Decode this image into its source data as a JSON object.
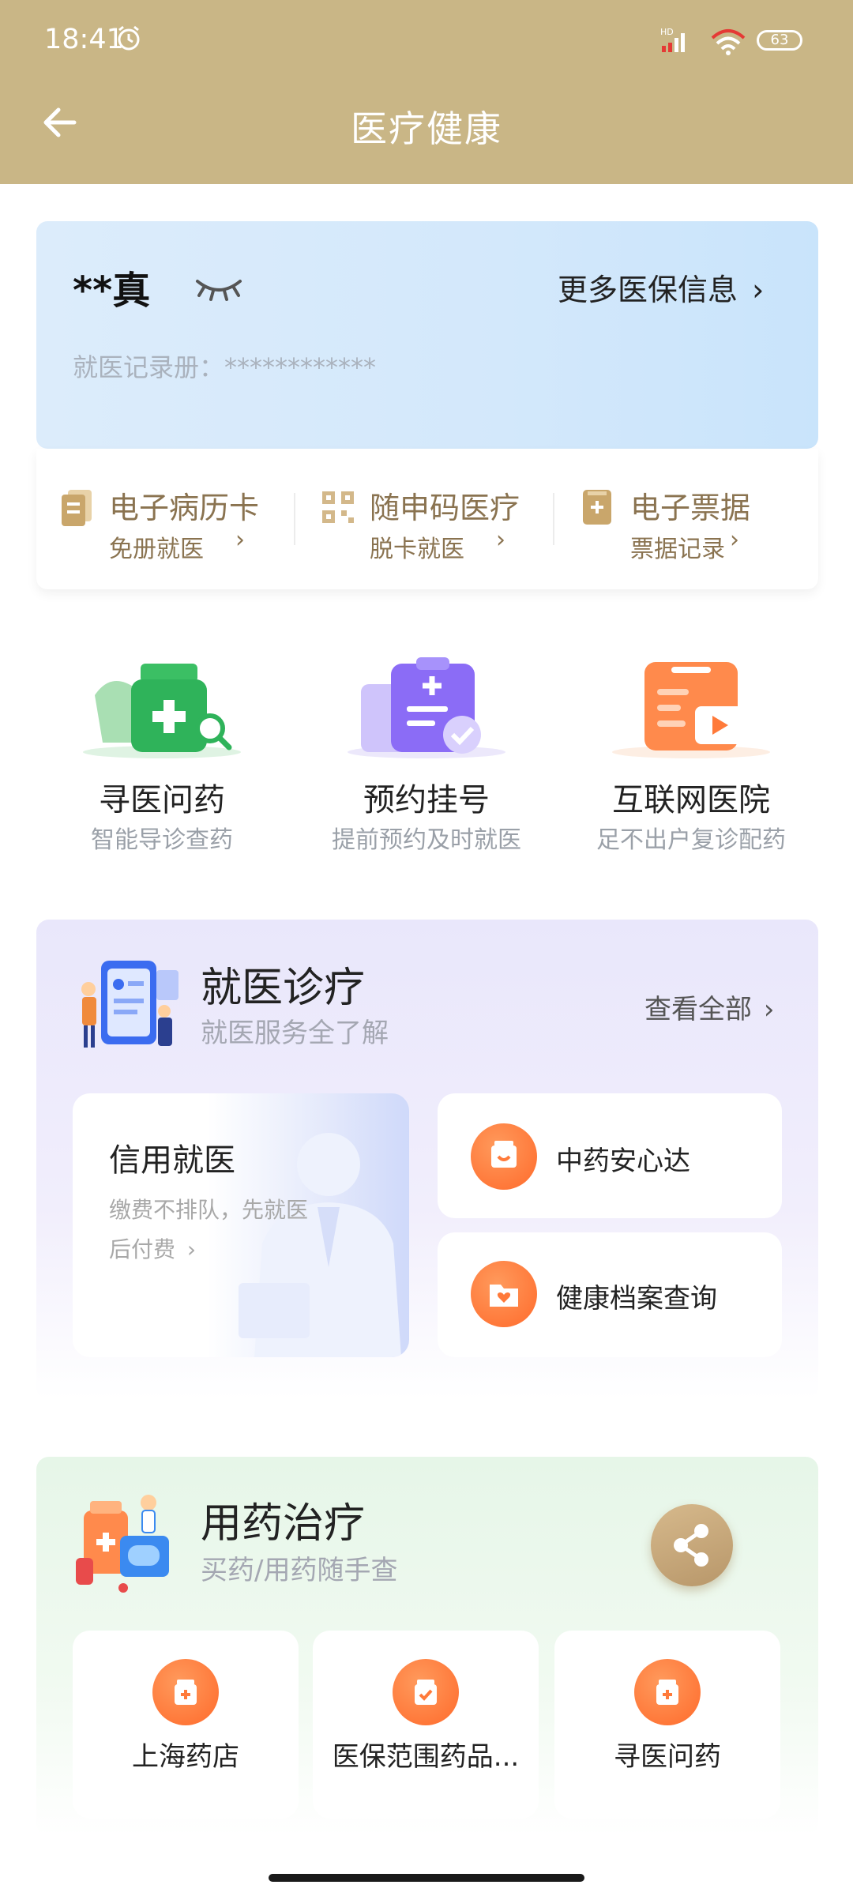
{
  "status_bar": {
    "time": "18:41",
    "battery": "63",
    "network": "HD"
  },
  "header": {
    "title": "医疗健康"
  },
  "user_card": {
    "name": "**真",
    "more_info": "更多医保信息",
    "record_label": "就医记录册：************"
  },
  "quick_items": [
    {
      "title": "电子病历卡",
      "subtitle": "免册就医"
    },
    {
      "title": "随申码医疗",
      "subtitle": "脱卡就医"
    },
    {
      "title": "电子票据",
      "subtitle": "票据记录"
    }
  ],
  "services": [
    {
      "title": "寻医问药",
      "subtitle": "智能导诊查药"
    },
    {
      "title": "预约挂号",
      "subtitle": "提前预约及时就医"
    },
    {
      "title": "互联网医院",
      "subtitle": "足不出户复诊配药"
    }
  ],
  "medical_section": {
    "title": "就医诊疗",
    "subtitle": "就医服务全了解",
    "view_all": "查看全部",
    "credit": {
      "title": "信用就医",
      "desc_line1": "缴费不排队，先就医",
      "desc_line2": "后付费"
    },
    "items": [
      {
        "label": "中药安心达"
      },
      {
        "label": "健康档案查询"
      }
    ]
  },
  "drug_section": {
    "title": "用药治疗",
    "subtitle": "买药/用药随手查",
    "items": [
      {
        "label": "上海药店"
      },
      {
        "label": "医保范围药品..."
      },
      {
        "label": "寻医问药"
      }
    ]
  },
  "colors": {
    "header": "#c9b686",
    "accent_gold": "#8a7350",
    "orange": "#ff6a2b"
  }
}
